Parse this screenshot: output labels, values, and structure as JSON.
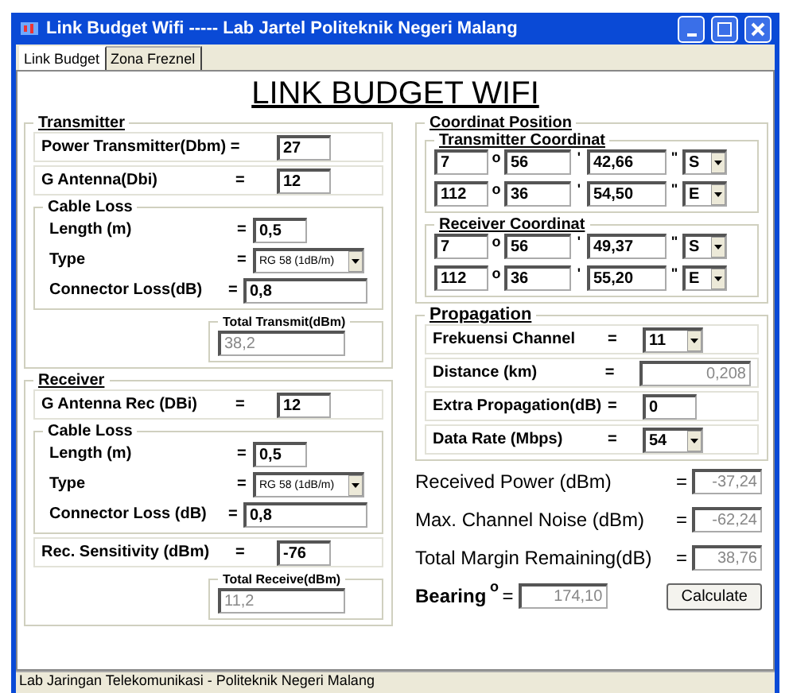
{
  "window": {
    "title": "Link Budget Wifi ----- Lab Jartel Politeknik Negeri Malang"
  },
  "tabs": [
    {
      "label": "Link Budget",
      "selected": true
    },
    {
      "label": "Zona Freznel",
      "selected": false
    }
  ],
  "heading": "LINK BUDGET WIFI",
  "transmitter": {
    "title": "Transmitter",
    "rows_before": [
      {
        "label": "Power Transmitter(Dbm) =",
        "value": "27",
        "kind": "input"
      },
      {
        "label": "G Antenna(Dbi)",
        "eq": "=",
        "value": "12",
        "kind": "input"
      }
    ],
    "cable_loss": {
      "title": "Cable Loss",
      "rows": [
        {
          "label": "Length (m)",
          "eq": "=",
          "value": "0,5",
          "kind": "input"
        },
        {
          "label": "Type",
          "eq": "=",
          "value": "RG 58 (1dB/m)",
          "kind": "select"
        },
        {
          "label": "Connector Loss(dB)",
          "eq": "=",
          "value": "0,8",
          "kind": "wide"
        }
      ]
    },
    "total": {
      "title": "Total Transmit(dBm)",
      "value": "38,2"
    }
  },
  "receiver": {
    "title": "Receiver",
    "rows_before": [
      {
        "label": "G Antenna Rec (DBi)",
        "eq": "=",
        "value": "12",
        "kind": "input"
      }
    ],
    "cable_loss": {
      "title": "Cable Loss",
      "rows": [
        {
          "label": "Length (m)",
          "eq": "=",
          "value": "0,5",
          "kind": "input"
        },
        {
          "label": "Type",
          "eq": "=",
          "value": "RG 58 (1dB/m)",
          "kind": "select"
        },
        {
          "label": "Connector Loss (dB)",
          "eq": "=",
          "value": "0,8",
          "kind": "wide"
        }
      ]
    },
    "rows_after": [
      {
        "label": "Rec. Sensitivity (dBm)",
        "eq": "=",
        "value": "-76",
        "kind": "input"
      }
    ],
    "total": {
      "title": "Total Receive(dBm)",
      "value": "11,2"
    }
  },
  "coordinates": {
    "title": "Coordinat Position",
    "groups": [
      {
        "title": "Transmitter Coordinat",
        "rows": [
          {
            "deg": "7",
            "deg_mark": "o",
            "min": "56",
            "min_mark": "'",
            "sec": "42,66",
            "sec_mark": "\"",
            "dir": "S"
          },
          {
            "deg": "112",
            "deg_mark": "o",
            "min": "36",
            "min_mark": "'",
            "sec": "54,50",
            "sec_mark": "\"",
            "dir": "E"
          }
        ]
      },
      {
        "title": "Receiver  Coordinat",
        "rows": [
          {
            "deg": "7",
            "deg_mark": "o",
            "min": "56",
            "min_mark": "'",
            "sec": "49,37",
            "sec_mark": "\"",
            "dir": "S"
          },
          {
            "deg": "112",
            "deg_mark": "o",
            "min": "36",
            "min_mark": "'",
            "sec": "55,20",
            "sec_mark": "\"",
            "dir": "E"
          }
        ]
      }
    ]
  },
  "propagation": {
    "title": "Propagation",
    "rows": [
      {
        "label": "Frekuensi Channel",
        "eq": "=",
        "value": "11",
        "kind": "select"
      },
      {
        "label": "Distance (km)",
        "eq": "=",
        "value": "0,208",
        "kind": "readonly"
      },
      {
        "label": "Extra Propagation(dB)",
        "eq": "=",
        "value": "0",
        "kind": "input"
      },
      {
        "label": "Data Rate (Mbps)",
        "eq": "=",
        "value": "54",
        "kind": "select"
      }
    ]
  },
  "results": [
    {
      "label": "Received Power (dBm)",
      "eq": "=",
      "value": "-37,24"
    },
    {
      "label": "Max. Channel Noise (dBm)",
      "eq": "=",
      "value": "-62,24"
    },
    {
      "label": "Total Margin Remaining(dB)",
      "eq": "=",
      "value": "38,76"
    }
  ],
  "bearing": {
    "label": "Bearing",
    "mark": "o",
    "eq": "=",
    "value": "174,10"
  },
  "button": "Calculate",
  "status_bar": "Lab Jaringan Telekomunikasi - Politeknik Negeri Malang"
}
